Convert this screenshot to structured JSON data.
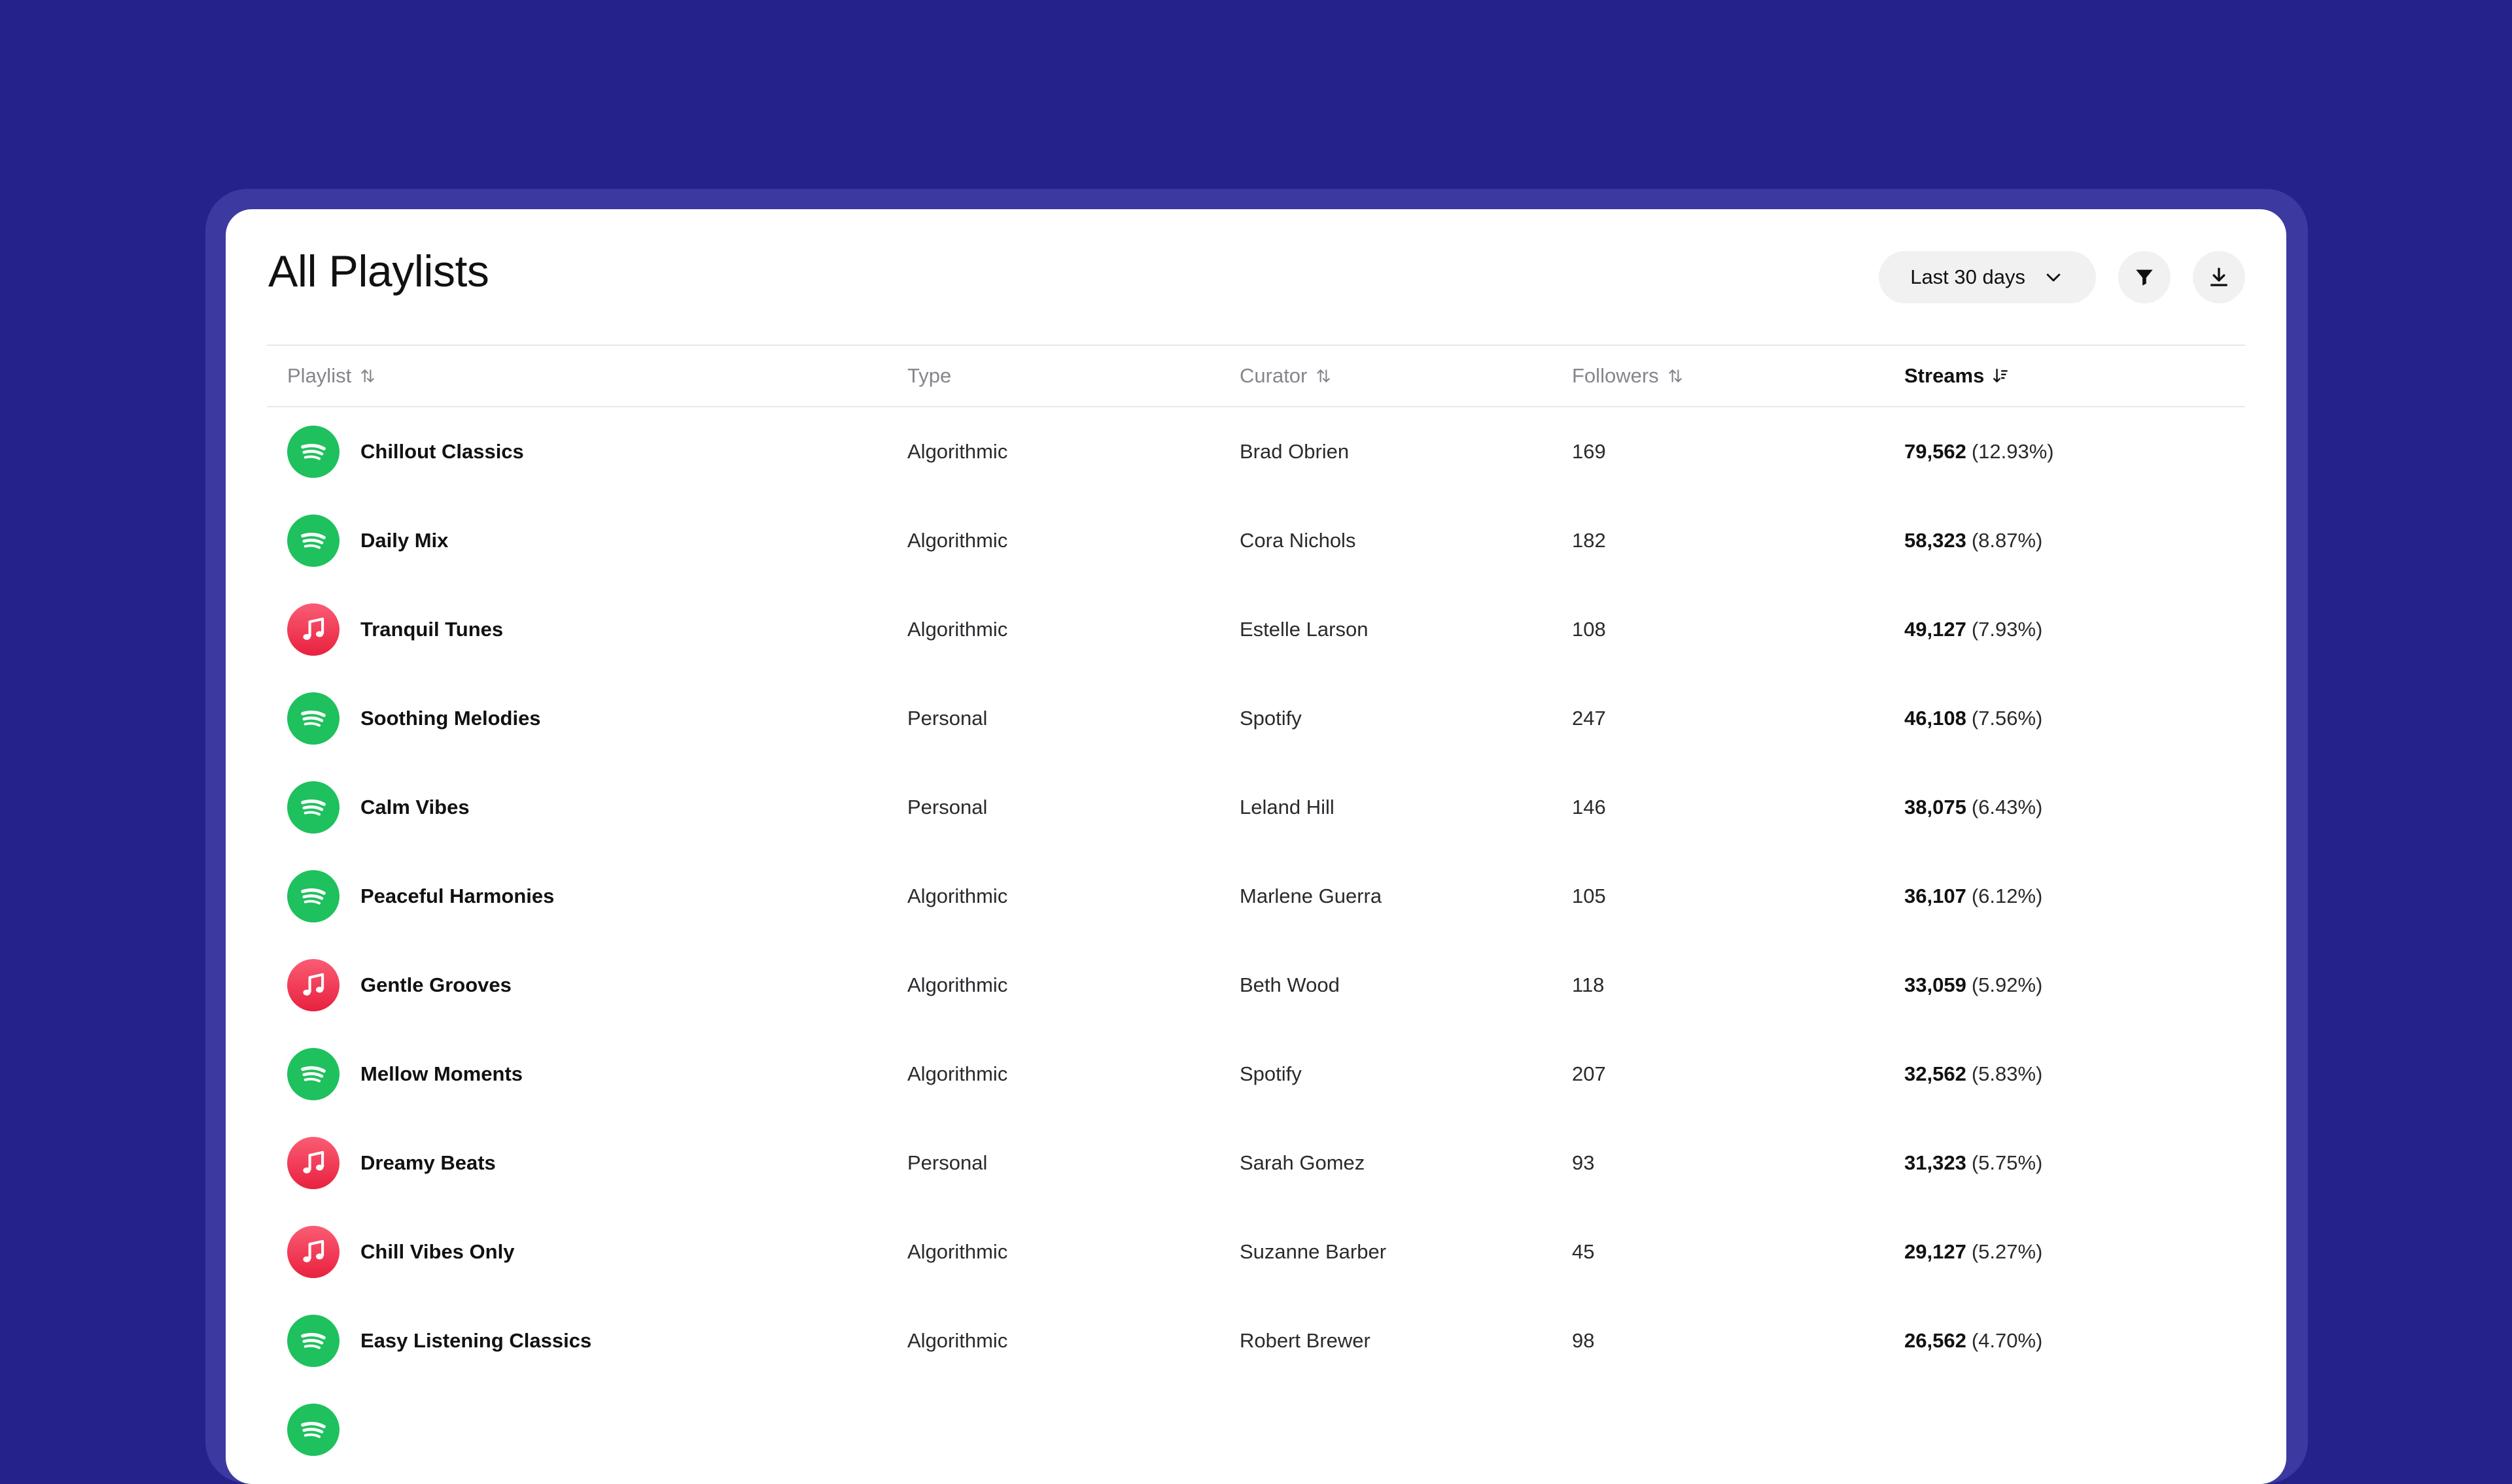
{
  "page": {
    "title": "All Playlists",
    "date_range": "Last 30 days",
    "icons": {
      "filter": "filter-icon",
      "download": "download-icon",
      "dropdown": "chevron-down-icon"
    }
  },
  "table": {
    "columns": [
      {
        "label": "Playlist",
        "sortable": true,
        "active": false
      },
      {
        "label": "Type",
        "sortable": false,
        "active": false
      },
      {
        "label": "Curator",
        "sortable": true,
        "active": false
      },
      {
        "label": "Followers",
        "sortable": true,
        "active": false
      },
      {
        "label": "Streams",
        "sortable": true,
        "active": true
      }
    ],
    "rows": [
      {
        "platform": "spotify",
        "name": "Chillout Classics",
        "type": "Algorithmic",
        "curator": "Brad Obrien",
        "followers": "169",
        "streams": "79,562",
        "share": "(12.93%)"
      },
      {
        "platform": "spotify",
        "name": "Daily Mix",
        "type": "Algorithmic",
        "curator": "Cora Nichols",
        "followers": "182",
        "streams": "58,323",
        "share": "(8.87%)"
      },
      {
        "platform": "apple",
        "name": "Tranquil Tunes",
        "type": "Algorithmic",
        "curator": "Estelle Larson",
        "followers": "108",
        "streams": "49,127",
        "share": "(7.93%)"
      },
      {
        "platform": "spotify",
        "name": "Soothing Melodies",
        "type": "Personal",
        "curator": "Spotify",
        "followers": "247",
        "streams": "46,108",
        "share": "(7.56%)"
      },
      {
        "platform": "spotify",
        "name": "Calm Vibes",
        "type": "Personal",
        "curator": "Leland Hill",
        "followers": "146",
        "streams": "38,075",
        "share": "(6.43%)"
      },
      {
        "platform": "spotify",
        "name": "Peaceful Harmonies",
        "type": "Algorithmic",
        "curator": "Marlene Guerra",
        "followers": "105",
        "streams": "36,107",
        "share": "(6.12%)"
      },
      {
        "platform": "apple",
        "name": "Gentle Grooves",
        "type": "Algorithmic",
        "curator": "Beth Wood",
        "followers": "118",
        "streams": "33,059",
        "share": "(5.92%)"
      },
      {
        "platform": "spotify",
        "name": "Mellow Moments",
        "type": "Algorithmic",
        "curator": "Spotify",
        "followers": "207",
        "streams": "32,562",
        "share": "(5.83%)"
      },
      {
        "platform": "apple",
        "name": "Dreamy Beats",
        "type": "Personal",
        "curator": "Sarah Gomez",
        "followers": "93",
        "streams": "31,323",
        "share": "(5.75%)"
      },
      {
        "platform": "apple",
        "name": "Chill Vibes Only",
        "type": "Algorithmic",
        "curator": "Suzanne Barber",
        "followers": "45",
        "streams": "29,127",
        "share": "(5.27%)"
      },
      {
        "platform": "spotify",
        "name": "Easy Listening Classics",
        "type": "Algorithmic",
        "curator": "Robert Brewer",
        "followers": "98",
        "streams": "26,562",
        "share": "(4.70%)"
      },
      {
        "platform": "spotify",
        "name": "",
        "type": "",
        "curator": "",
        "followers": "",
        "streams": "",
        "share": ""
      }
    ]
  },
  "colors": {
    "background": "#25238b",
    "frame": "#3c39a0",
    "spotify_green": "#1ec15d",
    "apple_red": "#f2354f"
  }
}
